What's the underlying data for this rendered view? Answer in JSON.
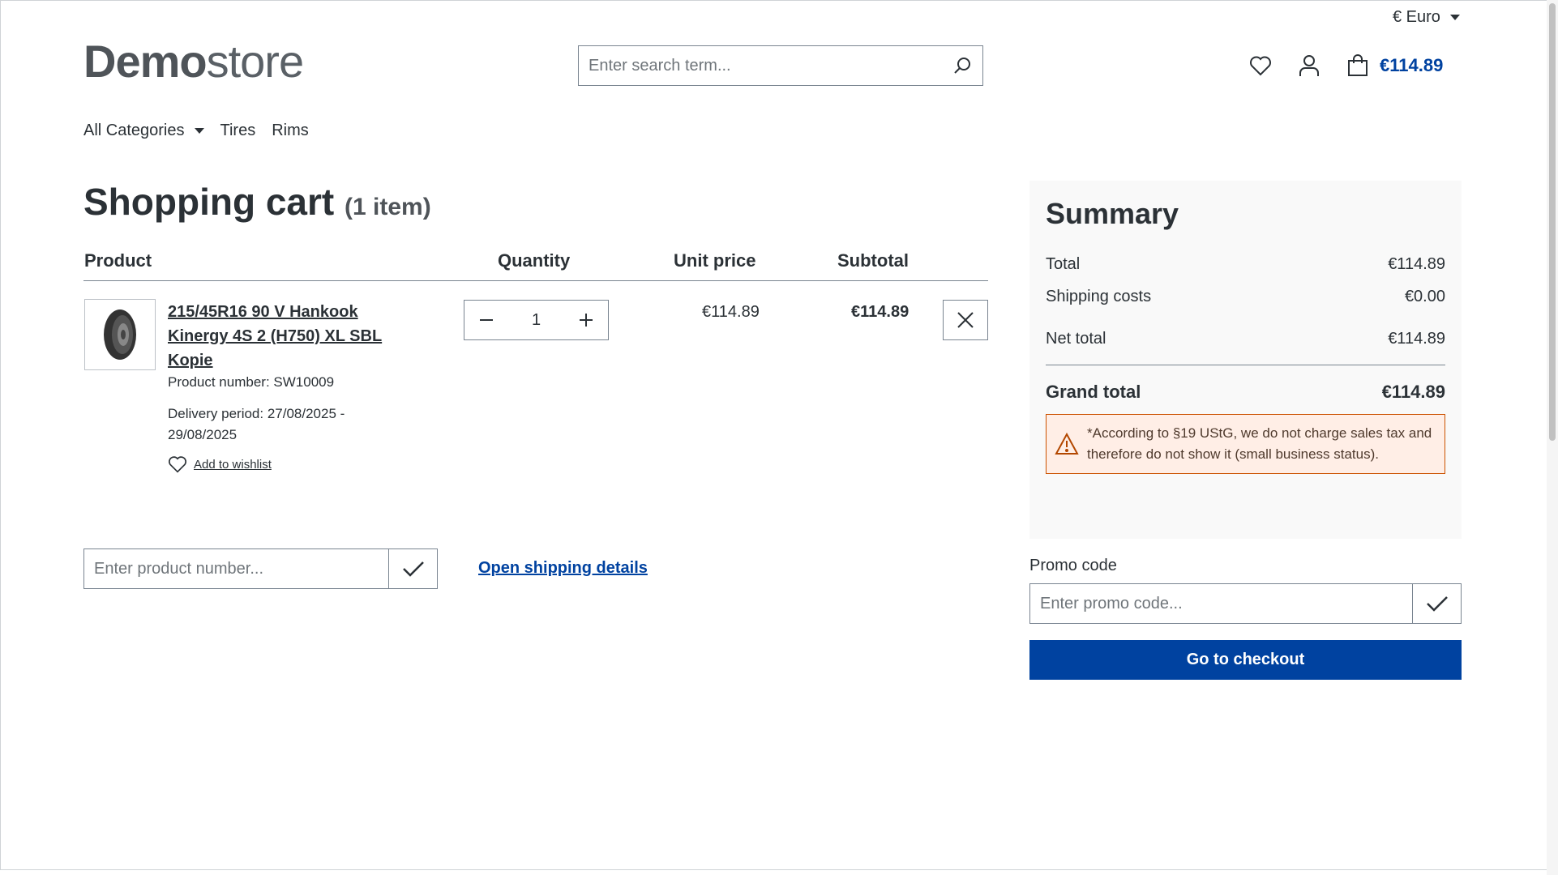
{
  "header": {
    "currency": "€ Euro",
    "logo_bold": "Demo",
    "logo_light": "store",
    "search_placeholder": "Enter search term...",
    "cart_total": "€114.89"
  },
  "nav": {
    "items": [
      "All Categories",
      "Tires",
      "Rims"
    ]
  },
  "cart": {
    "title": "Shopping cart",
    "count": "(1 item)",
    "columns": [
      "Product",
      "Quantity",
      "Unit price",
      "Subtotal"
    ],
    "item": {
      "name": "215/45R16 90 V Hankook Kinergy 4S 2 (H750) XL SBL Kopie",
      "product_number": "Product number: SW10009",
      "delivery": "Delivery period: 27/08/2025 - 29/08/2025",
      "wishlist": "Add to wishlist",
      "quantity": "1",
      "unit_price": "€114.89",
      "subtotal": "€114.89"
    },
    "product_number_placeholder": "Enter product number...",
    "shipping_link": "Open shipping details"
  },
  "summary": {
    "title": "Summary",
    "total_label": "Total",
    "total": "€114.89",
    "shipping_label": "Shipping costs",
    "shipping": "€0.00",
    "net_label": "Net total",
    "net": "€114.89",
    "grand_label": "Grand total",
    "grand": "€114.89",
    "notice": "*According to §19 UStG, we do not charge sales tax and therefore do not show it (small business status)."
  },
  "promo": {
    "label": "Promo code",
    "placeholder": "Enter promo code...",
    "checkout": "Go to checkout"
  },
  "colors": {
    "accent": "#0042a0",
    "warning_border": "#cc5200",
    "warning_bg": "#ffeee6"
  }
}
